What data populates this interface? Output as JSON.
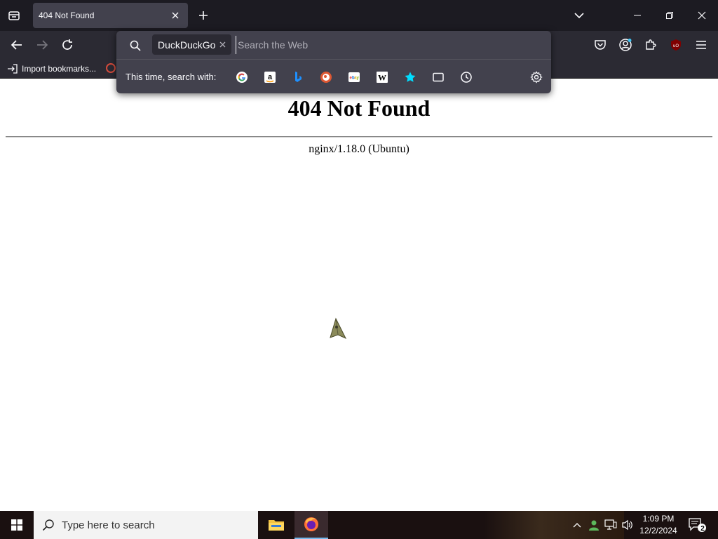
{
  "browser": {
    "tab": {
      "title": "404 Not Found"
    },
    "bookmarks": {
      "import_label": "Import bookmarks..."
    },
    "urlbar": {
      "engine_chip": "DuckDuckGo",
      "placeholder": "Search the Web",
      "search_with_label": "This time, search with:",
      "engines": [
        "google",
        "amazon",
        "bing",
        "duckduckgo",
        "ebay",
        "wikipedia",
        "bookmarks",
        "tabs",
        "history"
      ]
    }
  },
  "page": {
    "heading": "404 Not Found",
    "server": "nginx/1.18.0 (Ubuntu)"
  },
  "taskbar": {
    "search_placeholder": "Type here to search",
    "clock_time": "1:09 PM",
    "clock_date": "12/2/2024",
    "notification_count": "2"
  },
  "colors": {
    "tabstrip": "#1c1b22",
    "toolbar": "#2b2a33",
    "popup": "#42414d",
    "taskbar": "#1a1010"
  }
}
